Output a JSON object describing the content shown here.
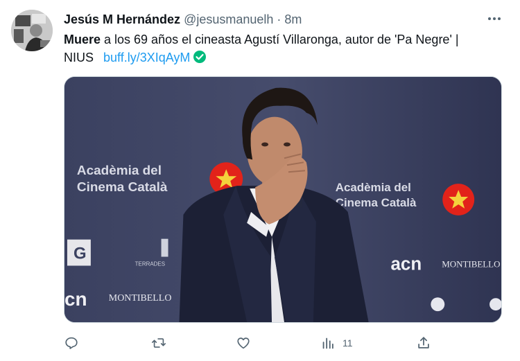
{
  "tweet": {
    "author": {
      "display_name": "Jesús M Hernández",
      "handle": "@jesusmanuelh",
      "separator": "·",
      "time": "8m"
    },
    "text": {
      "bold_word": "Muere",
      "body": " a los 69 años el cineasta Agustí Villaronga, autor de 'Pa Negre' | NIUS",
      "link": "buff.ly/3XIqAyM"
    },
    "media": {
      "backdrop_text_1": [
        "Acadèmia del",
        "Cinema Català"
      ],
      "backdrop_text_2": [
        "Acadèmia del",
        "Cinema Català"
      ],
      "sponsor_1": "MONTIBELLO",
      "sponsor_2": "acn",
      "sponsor_3": "MONTIBELLO",
      "sponsor_4": "TERRADES",
      "sponsor_5": "cn"
    },
    "actions": {
      "reply_icon": "reply-icon",
      "retweet_icon": "retweet-icon",
      "like_icon": "heart-icon",
      "views_icon": "views-icon",
      "views_count": "11",
      "share_icon": "share-icon"
    },
    "colors": {
      "link": "#1d9bf0",
      "secondary_text": "#536471",
      "verified": "#00ba7c",
      "backdrop": "#3a3f5c",
      "badge_red": "#e2231a"
    }
  }
}
